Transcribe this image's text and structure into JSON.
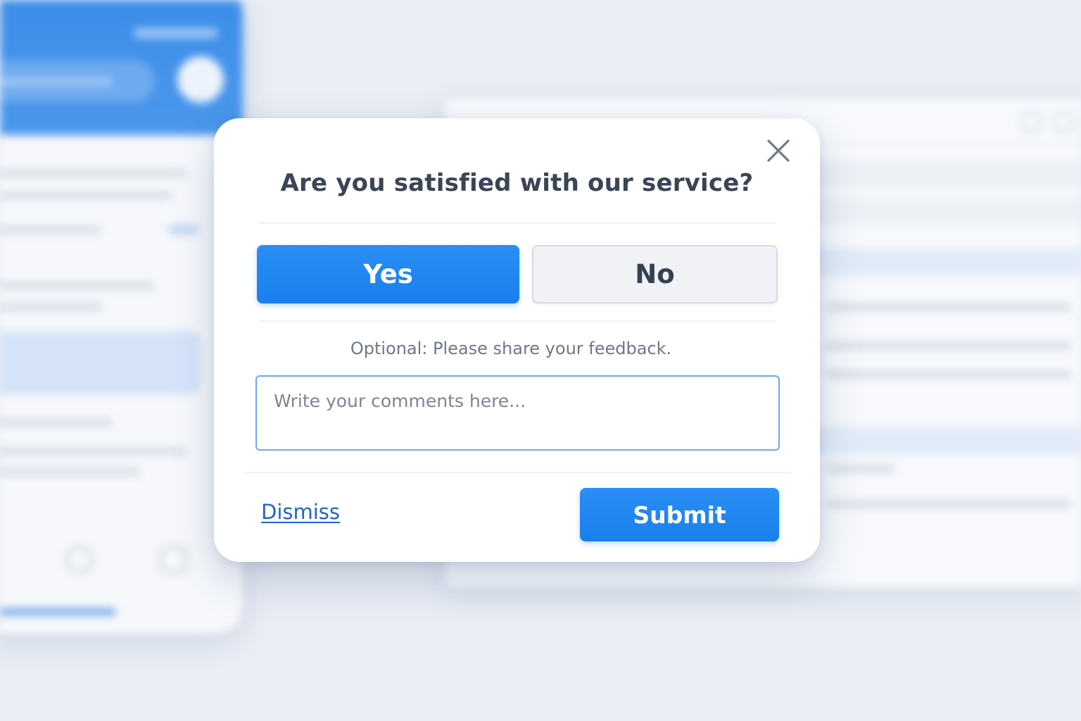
{
  "dialog": {
    "title": "Are you satisfied with our service?",
    "yes_label": "Yes",
    "no_label": "No",
    "feedback_prompt": "Optional: Please share your feedback.",
    "comments": {
      "placeholder": "Write your comments here...",
      "value": ""
    },
    "dismiss_label": "Dismiss",
    "submit_label": "Submit",
    "close_icon": "close-icon"
  },
  "colors": {
    "accent": "#1a7fee",
    "link": "#1f66c9",
    "title": "#3a4556",
    "secondary_button_bg": "#f1f2f5",
    "input_border": "#6aaaf0"
  }
}
